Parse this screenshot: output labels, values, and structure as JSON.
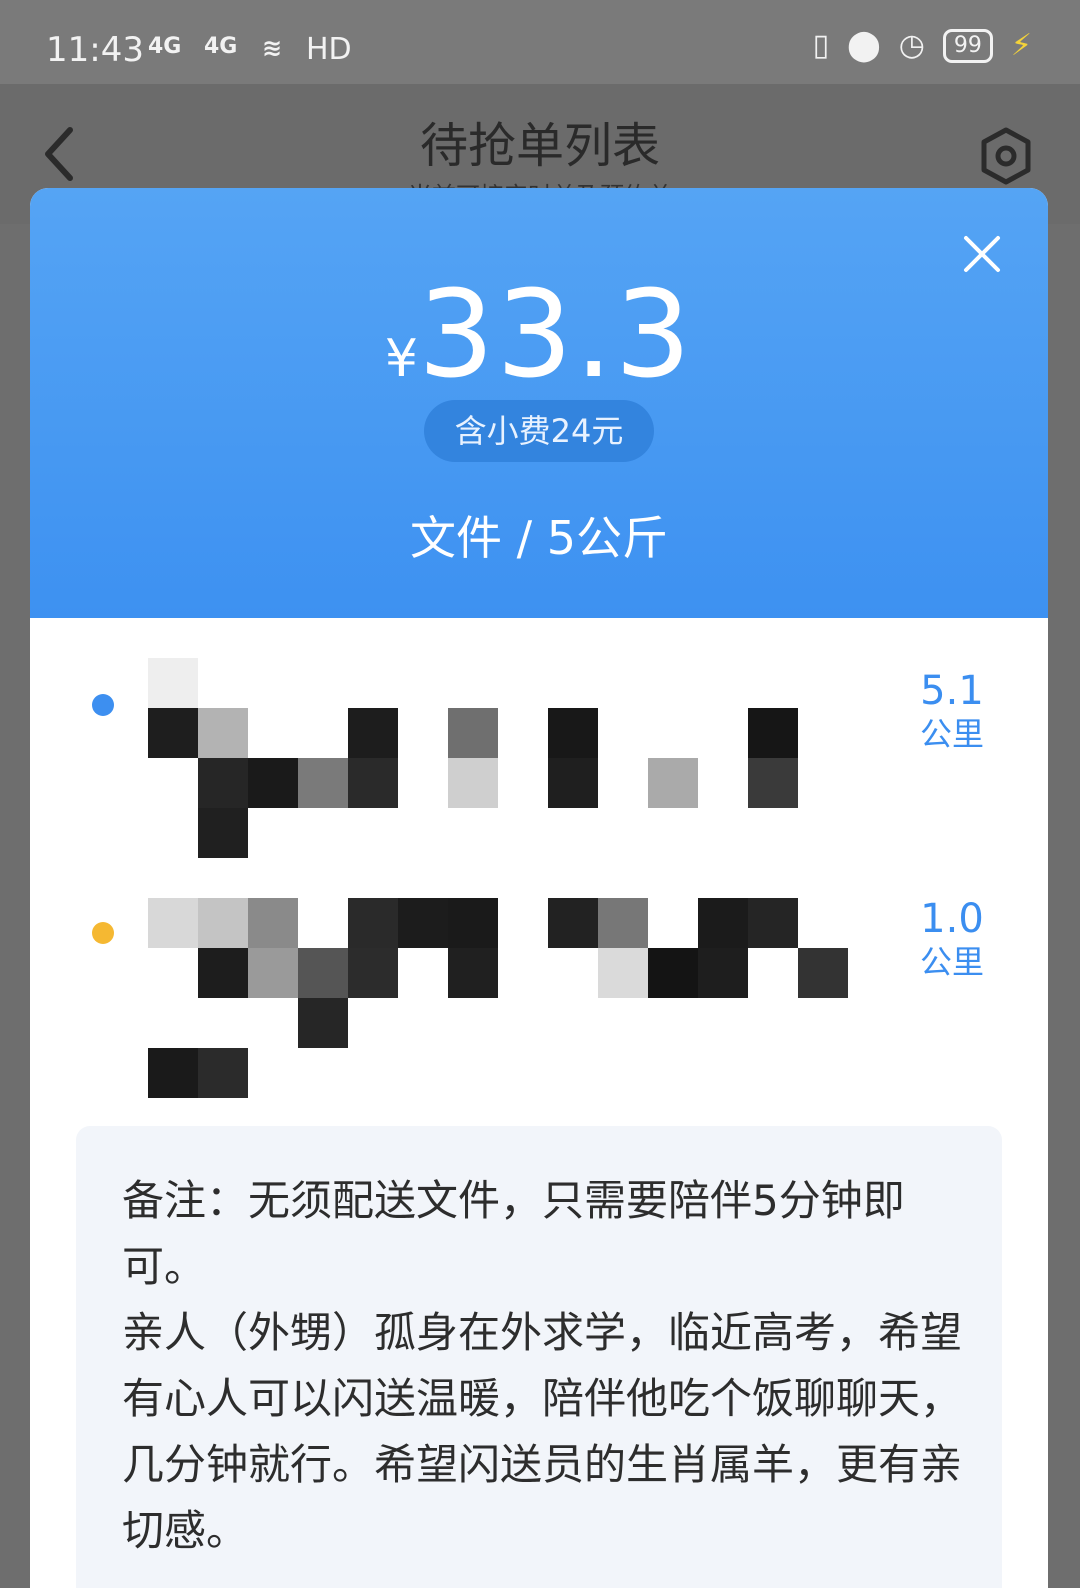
{
  "status_bar": {
    "time": "11:43",
    "signal1": "4G",
    "signal2": "4G",
    "network": "HD",
    "battery": "99",
    "icons": [
      "vibrate-icon",
      "location-icon",
      "alarm-icon",
      "battery-icon",
      "charging-icon"
    ]
  },
  "header": {
    "title": "待抢单列表",
    "subtitle": "当前可接实时单及预约单"
  },
  "order": {
    "currency": "¥",
    "price": "33.3",
    "tip": "含小费24元",
    "cargo": "文件 / 5公斤"
  },
  "route": [
    {
      "dot_color": "#3d8ff0",
      "distance": "5.1",
      "unit": "公里"
    },
    {
      "dot_color": "#f5b832",
      "distance": "1.0",
      "unit": "公里"
    }
  ],
  "note": {
    "text": "备注：无须配送文件，只需要陪伴5分钟即可。\n亲人（外甥）孤身在外求学，临近高考，希望有心人可以闪送温暖，陪伴他吃个饭聊聊天，几分钟就行。希望闪送员的生肖属羊，更有亲切感。"
  },
  "colors": {
    "accent": "#3d91f1",
    "distance": "#3b8ef0"
  }
}
